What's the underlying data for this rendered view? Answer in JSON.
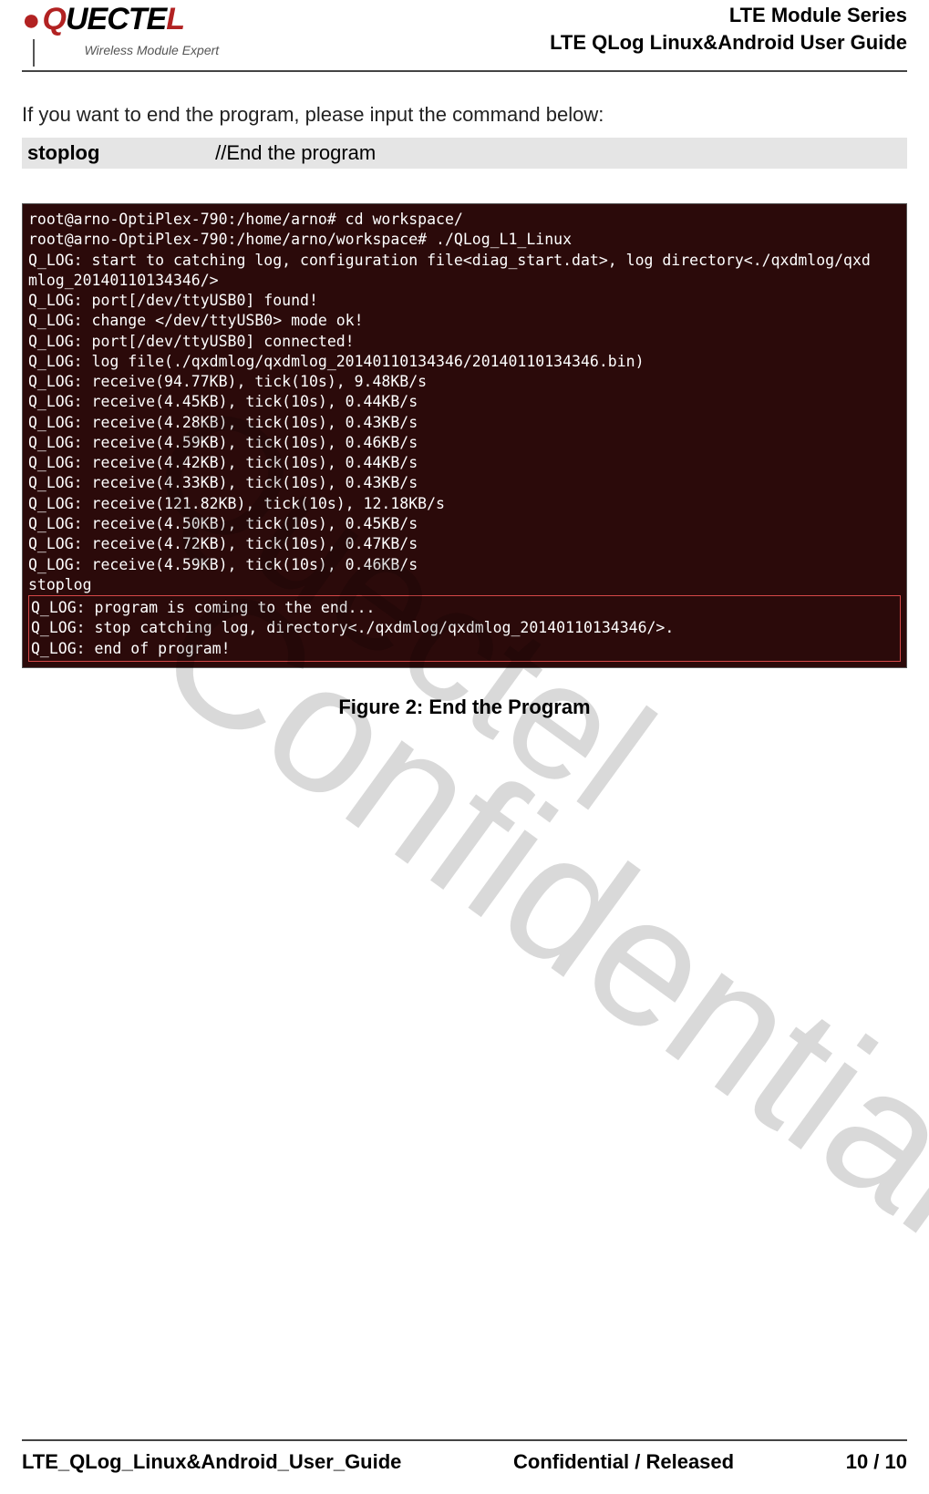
{
  "header": {
    "brand_main": "QUECTEL",
    "brand_sub": "Wireless Module Expert",
    "line1": "LTE  Module  Series",
    "line2": "LTE  QLog  Linux&Android  User  Guide"
  },
  "intro": "If you want to end the program, please input the command below:",
  "command": {
    "cmd": "stoplog",
    "comment": "//End the program"
  },
  "terminal": {
    "lines": [
      "root@arno-OptiPlex-790:/home/arno# cd workspace/",
      "root@arno-OptiPlex-790:/home/arno/workspace# ./QLog_L1_Linux",
      "Q_LOG: start to catching log, configuration file<diag_start.dat>, log directory<./qxdmlog/qxd",
      "mlog_20140110134346/>",
      "Q_LOG: port[/dev/ttyUSB0] found!",
      "Q_LOG: change </dev/ttyUSB0> mode ok!",
      "Q_LOG: port[/dev/ttyUSB0] connected!",
      "Q_LOG: log file(./qxdmlog/qxdmlog_20140110134346/20140110134346.bin)",
      "Q_LOG: receive(94.77KB), tick(10s), 9.48KB/s",
      "Q_LOG: receive(4.45KB), tick(10s), 0.44KB/s",
      "Q_LOG: receive(4.28KB), tick(10s), 0.43KB/s",
      "Q_LOG: receive(4.59KB), tick(10s), 0.46KB/s",
      "Q_LOG: receive(4.42KB), tick(10s), 0.44KB/s",
      "Q_LOG: receive(4.33KB), tick(10s), 0.43KB/s",
      "Q_LOG: receive(121.82KB), tick(10s), 12.18KB/s",
      "Q_LOG: receive(4.50KB), tick(10s), 0.45KB/s",
      "Q_LOG: receive(4.72KB), tick(10s), 0.47KB/s",
      "Q_LOG: receive(4.59KB), tick(10s), 0.46KB/s",
      "stoplog"
    ],
    "boxed": [
      "Q_LOG: program is coming to the end...",
      "Q_LOG: stop catching log, directory<./qxdmlog/qxdmlog_20140110134346/>.",
      "Q_LOG: end of program!"
    ]
  },
  "caption": "Figure 2: End the Program",
  "watermarks": {
    "w1": "Quectel",
    "w2": "Confidential"
  },
  "footer": {
    "left": "LTE_QLog_Linux&Android_User_Guide",
    "center": "Confidential / Released",
    "right": "10 / 10"
  }
}
